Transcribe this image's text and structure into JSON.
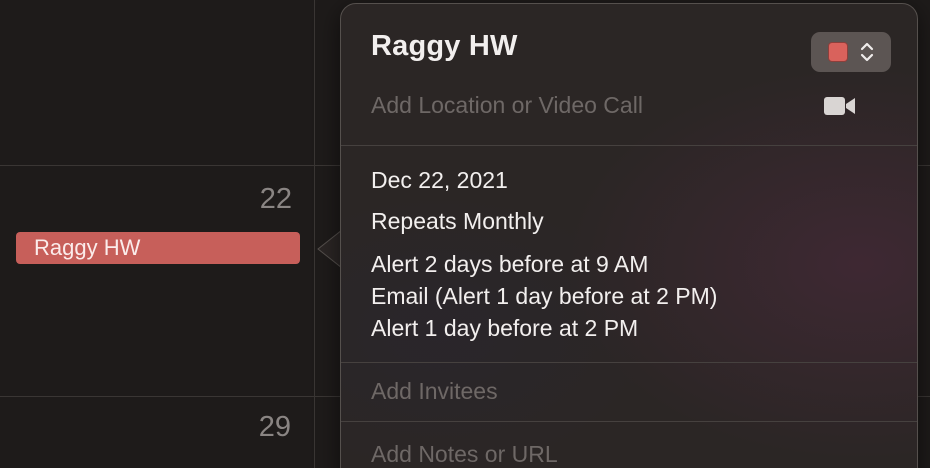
{
  "calendar": {
    "day_numbers": [
      "22",
      "29"
    ],
    "event": {
      "title": "Raggy HW",
      "color": "#c75f5a"
    }
  },
  "popover": {
    "title": "Raggy HW",
    "calendar_color": "#d9625c",
    "location_placeholder": "Add Location or Video Call",
    "icons": [
      "chevron-up-down-icon",
      "video-camera-icon"
    ],
    "date": "Dec 22, 2021",
    "repeat": "Repeats Monthly",
    "alerts": [
      "Alert 2 days before at 9 AM",
      "Email (Alert 1 day before at 2 PM)",
      "Alert 1 day before at 2 PM"
    ],
    "invitees_placeholder": "Add Invitees",
    "notes_placeholder": "Add Notes or URL"
  }
}
